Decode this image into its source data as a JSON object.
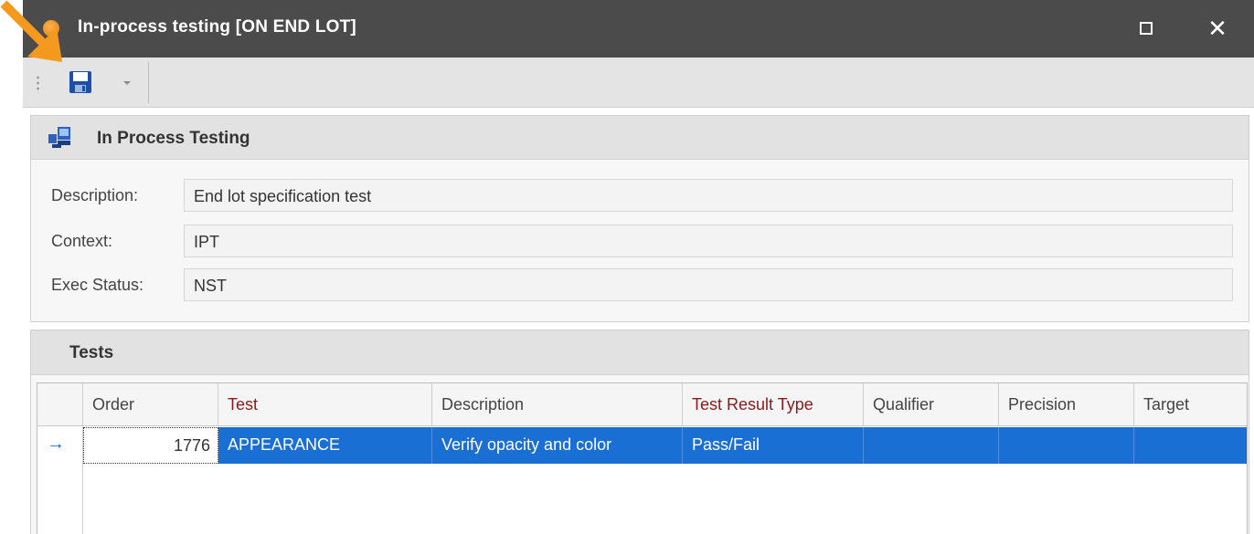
{
  "window": {
    "title": "In-process testing [ON END LOT]",
    "maximize_glyph": "□",
    "close_glyph": "✕"
  },
  "toolbar": {
    "save_icon": "floppy-disk-icon",
    "dropdown_icon": "chevron-down-icon"
  },
  "ipt_group": {
    "title": "In Process Testing",
    "icon": "test-equipment-icon",
    "fields": [
      {
        "label": "Description:",
        "value": "End lot specification test"
      },
      {
        "label": "Context:",
        "value": "IPT"
      },
      {
        "label": "Exec Status:",
        "value": "NST"
      }
    ]
  },
  "tests_group": {
    "title": "Tests",
    "columns": [
      "Order",
      "Test",
      "Description",
      "Test Result Type",
      "Qualifier",
      "Precision",
      "Target"
    ],
    "rows": [
      {
        "indicator": "→",
        "order": "1776",
        "test": "APPEARANCE",
        "description": "Verify opacity and color",
        "test_result_type": "Pass/Fail",
        "qualifier": "",
        "precision": "",
        "target": ""
      }
    ]
  },
  "colors": {
    "titlebar": "#4b4b4b",
    "selection": "#1a6fd4",
    "required_header": "#8b1a1a",
    "annotation_arrow": "#f39a1e"
  }
}
